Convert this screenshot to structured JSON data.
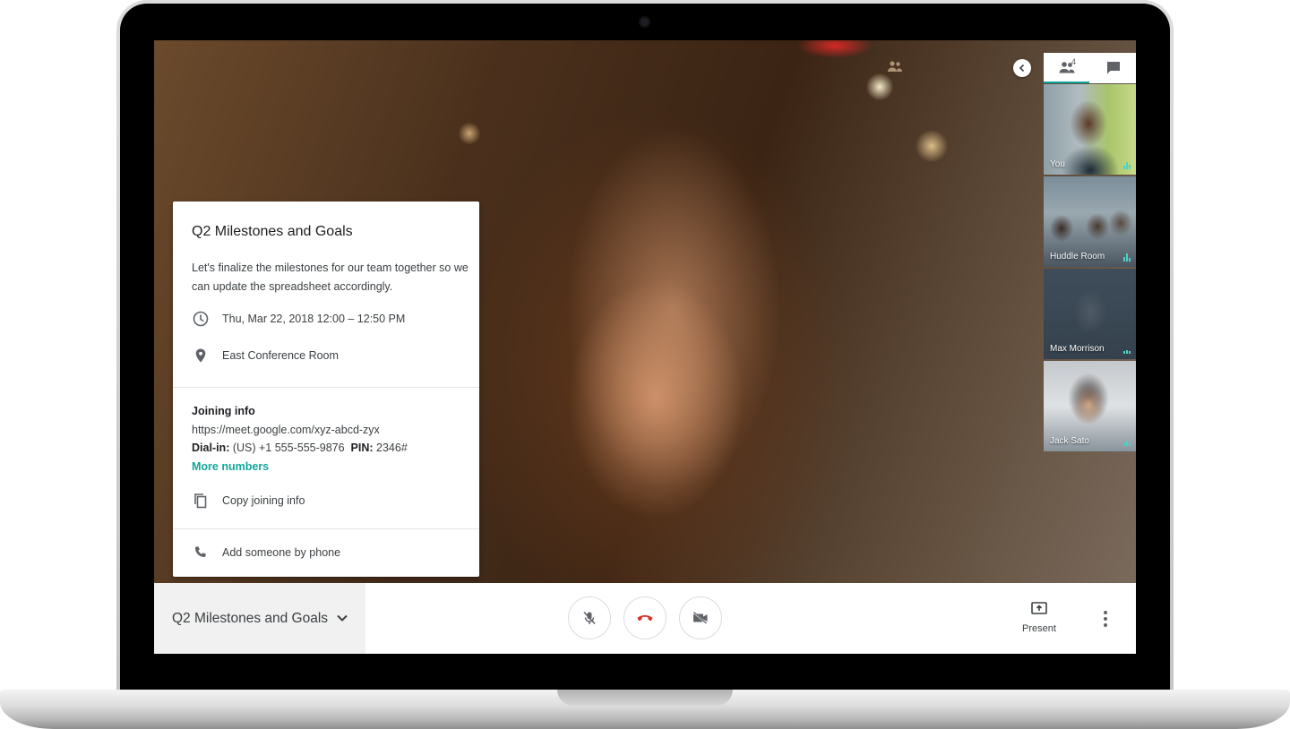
{
  "card": {
    "title": "Q2 Milestones and Goals",
    "description": "Let's finalize the milestones for our team together so we can update the spreadsheet accordingly.",
    "datetime": "Thu, Mar 22, 2018 12:00 – 12:50 PM",
    "location": "East Conference Room",
    "joining_title": "Joining info",
    "joining_url": "https://meet.google.com/xyz-abcd-zyx",
    "dialin_label": "Dial-in:",
    "dialin_number": "(US) +1 555-555-9876",
    "pin_label": "PIN:",
    "pin_value": "2346#",
    "more_numbers": "More numbers",
    "copy_info": "Copy joining info",
    "add_by_phone": "Add someone by phone"
  },
  "panel": {
    "participant_count": "4",
    "participants": [
      {
        "name": "You"
      },
      {
        "name": "Huddle Room"
      },
      {
        "name": "Max Morrison"
      },
      {
        "name": "Jack Sato"
      }
    ]
  },
  "bottom_bar": {
    "meeting_title": "Q2 Milestones and Goals",
    "present_label": "Present"
  },
  "colors": {
    "accent": "#12a79c",
    "hangup": "#d93025",
    "text": "#3c4043"
  },
  "icons": [
    "clock-icon",
    "location-pin-icon",
    "copy-icon",
    "phone-icon",
    "chevron-left-icon",
    "people-icon",
    "chat-icon",
    "chevron-down-icon",
    "mic-off-icon",
    "hang-up-icon",
    "camera-off-icon",
    "present-screen-icon",
    "more-vert-icon"
  ]
}
